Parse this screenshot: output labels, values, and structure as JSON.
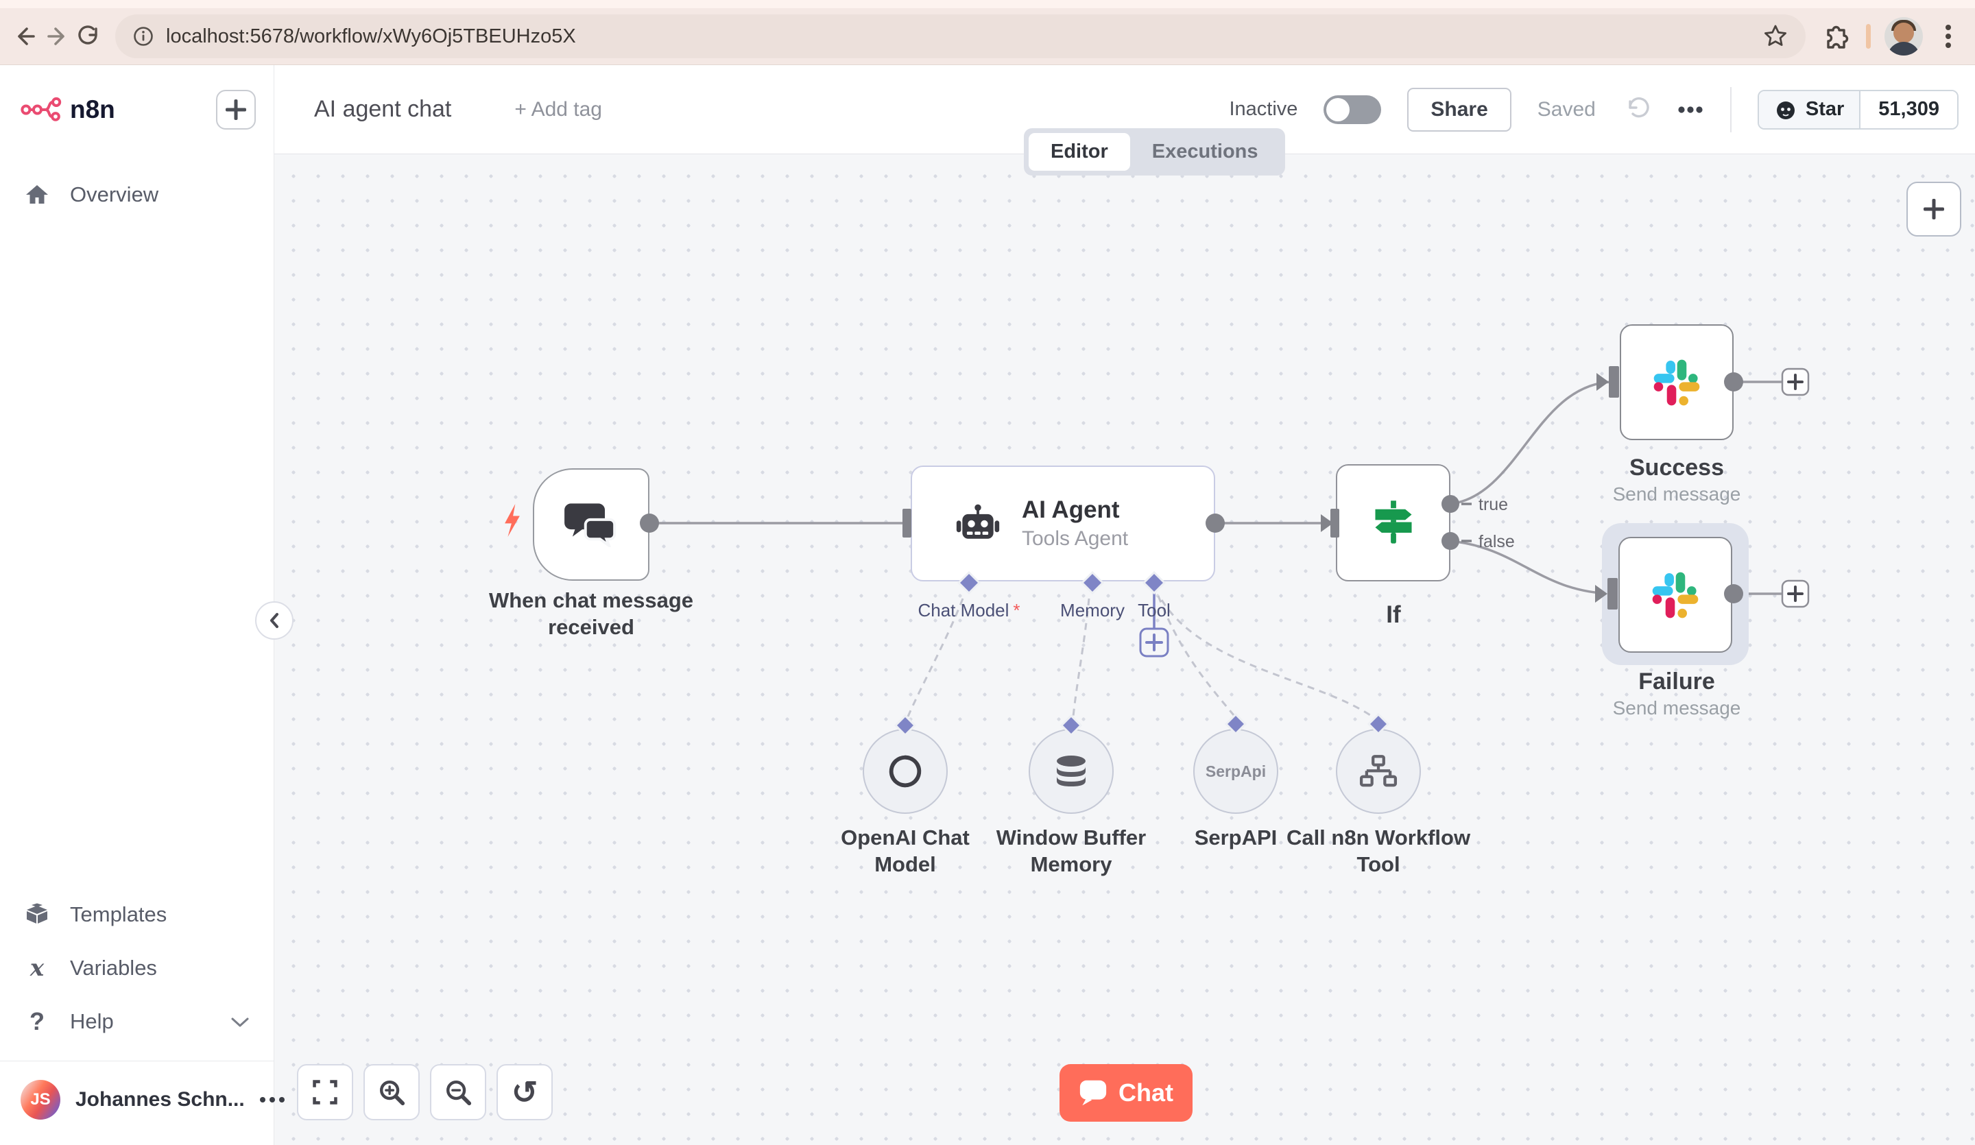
{
  "browser": {
    "url": "localhost:5678/workflow/xWy6Oj5TBEUHzo5X"
  },
  "sidebar": {
    "logo_text": "n8n",
    "items": [
      {
        "label": "Overview"
      },
      {
        "label": "Templates"
      },
      {
        "label": "Variables"
      },
      {
        "label": "Help"
      }
    ],
    "user": {
      "initials": "JS",
      "name": "Johannes Schn..."
    }
  },
  "header": {
    "title": "AI agent chat",
    "add_tag_label": "+ Add tag",
    "activation_label": "Inactive",
    "share_label": "Share",
    "saved_label": "Saved",
    "github": {
      "star_label": "Star",
      "star_count": "51,309"
    }
  },
  "tabs": {
    "editor": "Editor",
    "executions": "Executions"
  },
  "canvas": {
    "trigger": {
      "label": "When chat message received"
    },
    "agent": {
      "title": "AI Agent",
      "subtitle": "Tools Agent",
      "required_marker": "*",
      "ports": [
        {
          "label": "Chat Model"
        },
        {
          "label": "Memory"
        },
        {
          "label": "Tool"
        }
      ]
    },
    "if_node": {
      "label": "If",
      "outputs": [
        "true",
        "false"
      ]
    },
    "success": {
      "label": "Success",
      "sublabel": "Send message"
    },
    "failure": {
      "label": "Failure",
      "sublabel": "Send message"
    },
    "subnodes": [
      {
        "label": "OpenAI Chat Model"
      },
      {
        "label": "Window Buffer Memory"
      },
      {
        "label": "SerpAPI",
        "icon_text": "SerpApi"
      },
      {
        "label": "Call n8n Workflow Tool"
      }
    ],
    "chat_button_label": "Chat"
  },
  "colors": {
    "brand_pink": "#EA4B71",
    "chat_button": "#FF6D5A",
    "node_purple": "#7E84C5",
    "if_green": "#17994E",
    "slack_blue": "#36C5F0",
    "slack_green": "#2EB67D",
    "slack_yellow": "#ECB22E",
    "slack_red": "#E01E5A",
    "trigger_bolt": "#FF6D5A"
  }
}
